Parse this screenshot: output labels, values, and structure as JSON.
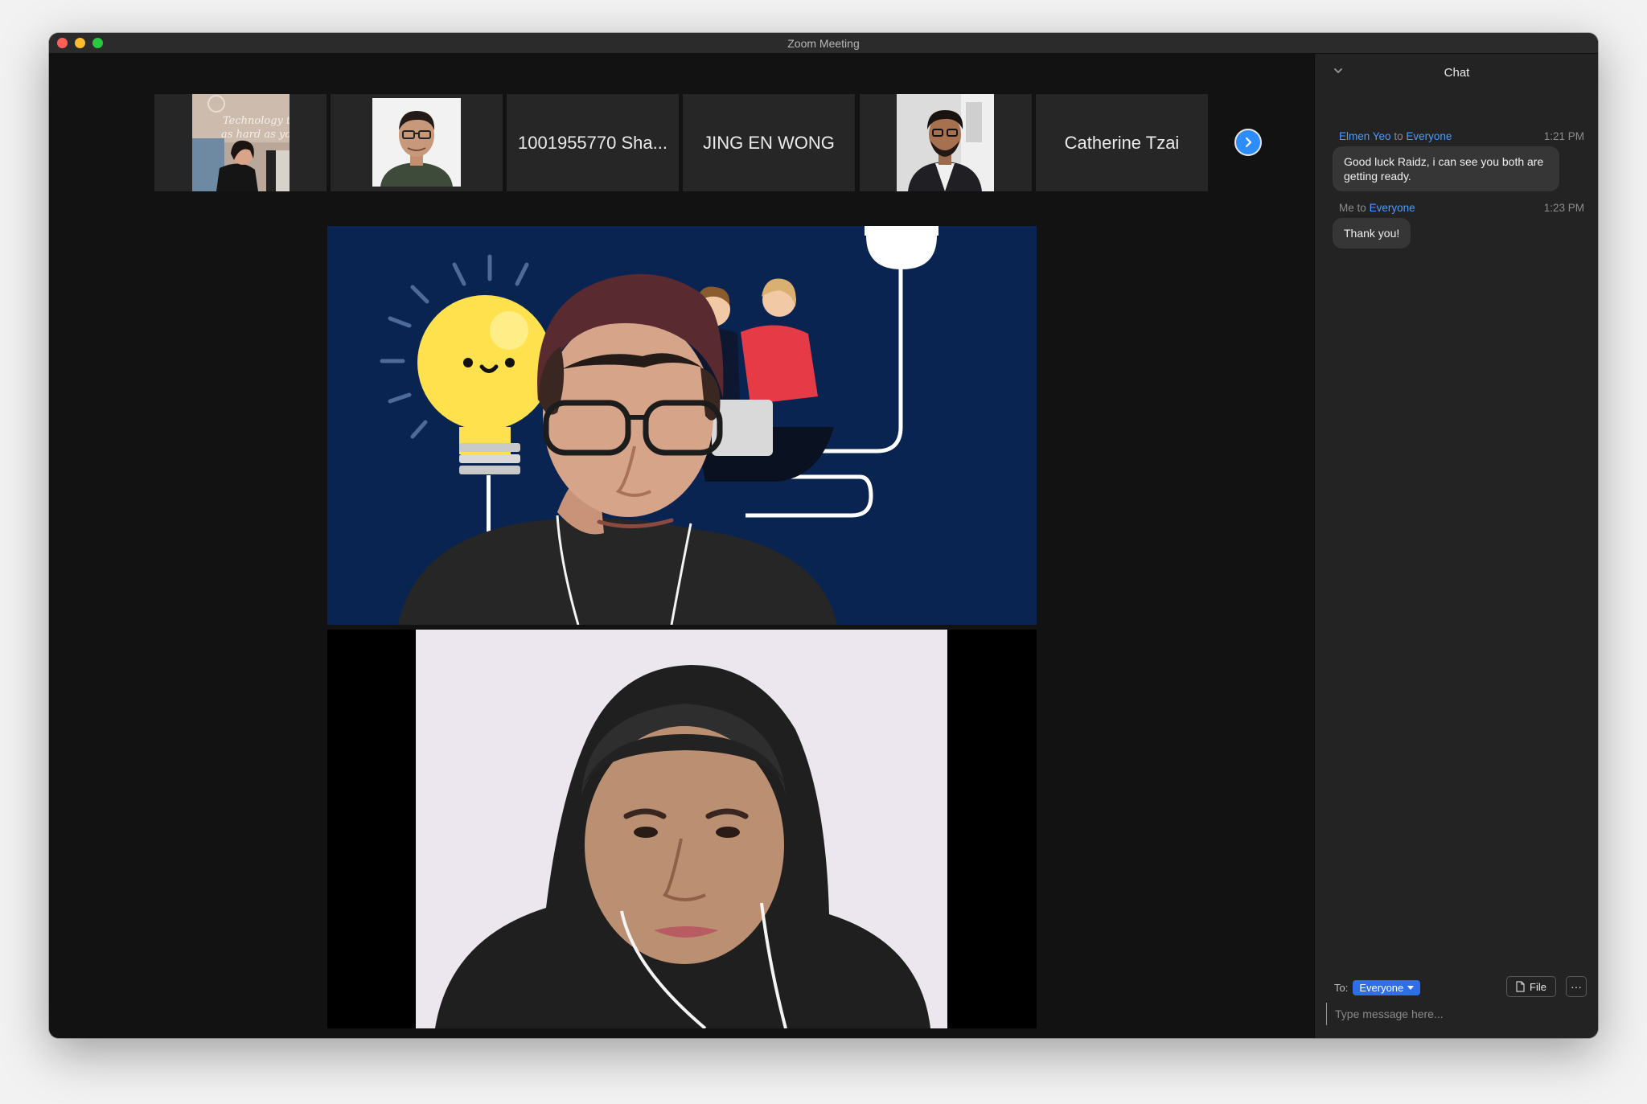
{
  "window": {
    "title": "Zoom Meeting"
  },
  "participants_strip": [
    {
      "kind": "video",
      "label": ""
    },
    {
      "kind": "video",
      "label": ""
    },
    {
      "kind": "name",
      "label": "1001955770 Sha..."
    },
    {
      "kind": "name",
      "label": "JING EN WONG"
    },
    {
      "kind": "video",
      "label": ""
    },
    {
      "kind": "name",
      "label": "Catherine Tzai"
    }
  ],
  "thumb_text": [
    "Technology th",
    "as hard as you"
  ],
  "chat": {
    "title": "Chat",
    "messages": [
      {
        "from": "Elmen Yeo",
        "to_word": "to",
        "to": "Everyone",
        "time": "1:21 PM",
        "text": "Good luck Raidz, i can see you both are getting ready."
      },
      {
        "from": "Me",
        "to_word": "to",
        "to": "Everyone",
        "time": "1:23 PM",
        "text": "Thank you!"
      }
    ],
    "to_label": "To:",
    "recipient": "Everyone",
    "file_label": "File",
    "more_label": "···",
    "input_placeholder": "Type message here..."
  },
  "colors": {
    "accent": "#2d8cff",
    "link_blue": "#4a9cff",
    "window_bg": "#1a1a1a",
    "virtual_bg_navy": "#0a2451",
    "bulb_yellow": "#ffe14d"
  },
  "icons": [
    "chevron-down-icon",
    "chevron-right-icon",
    "file-icon",
    "caret-down-icon",
    "lightbulb-icon"
  ]
}
